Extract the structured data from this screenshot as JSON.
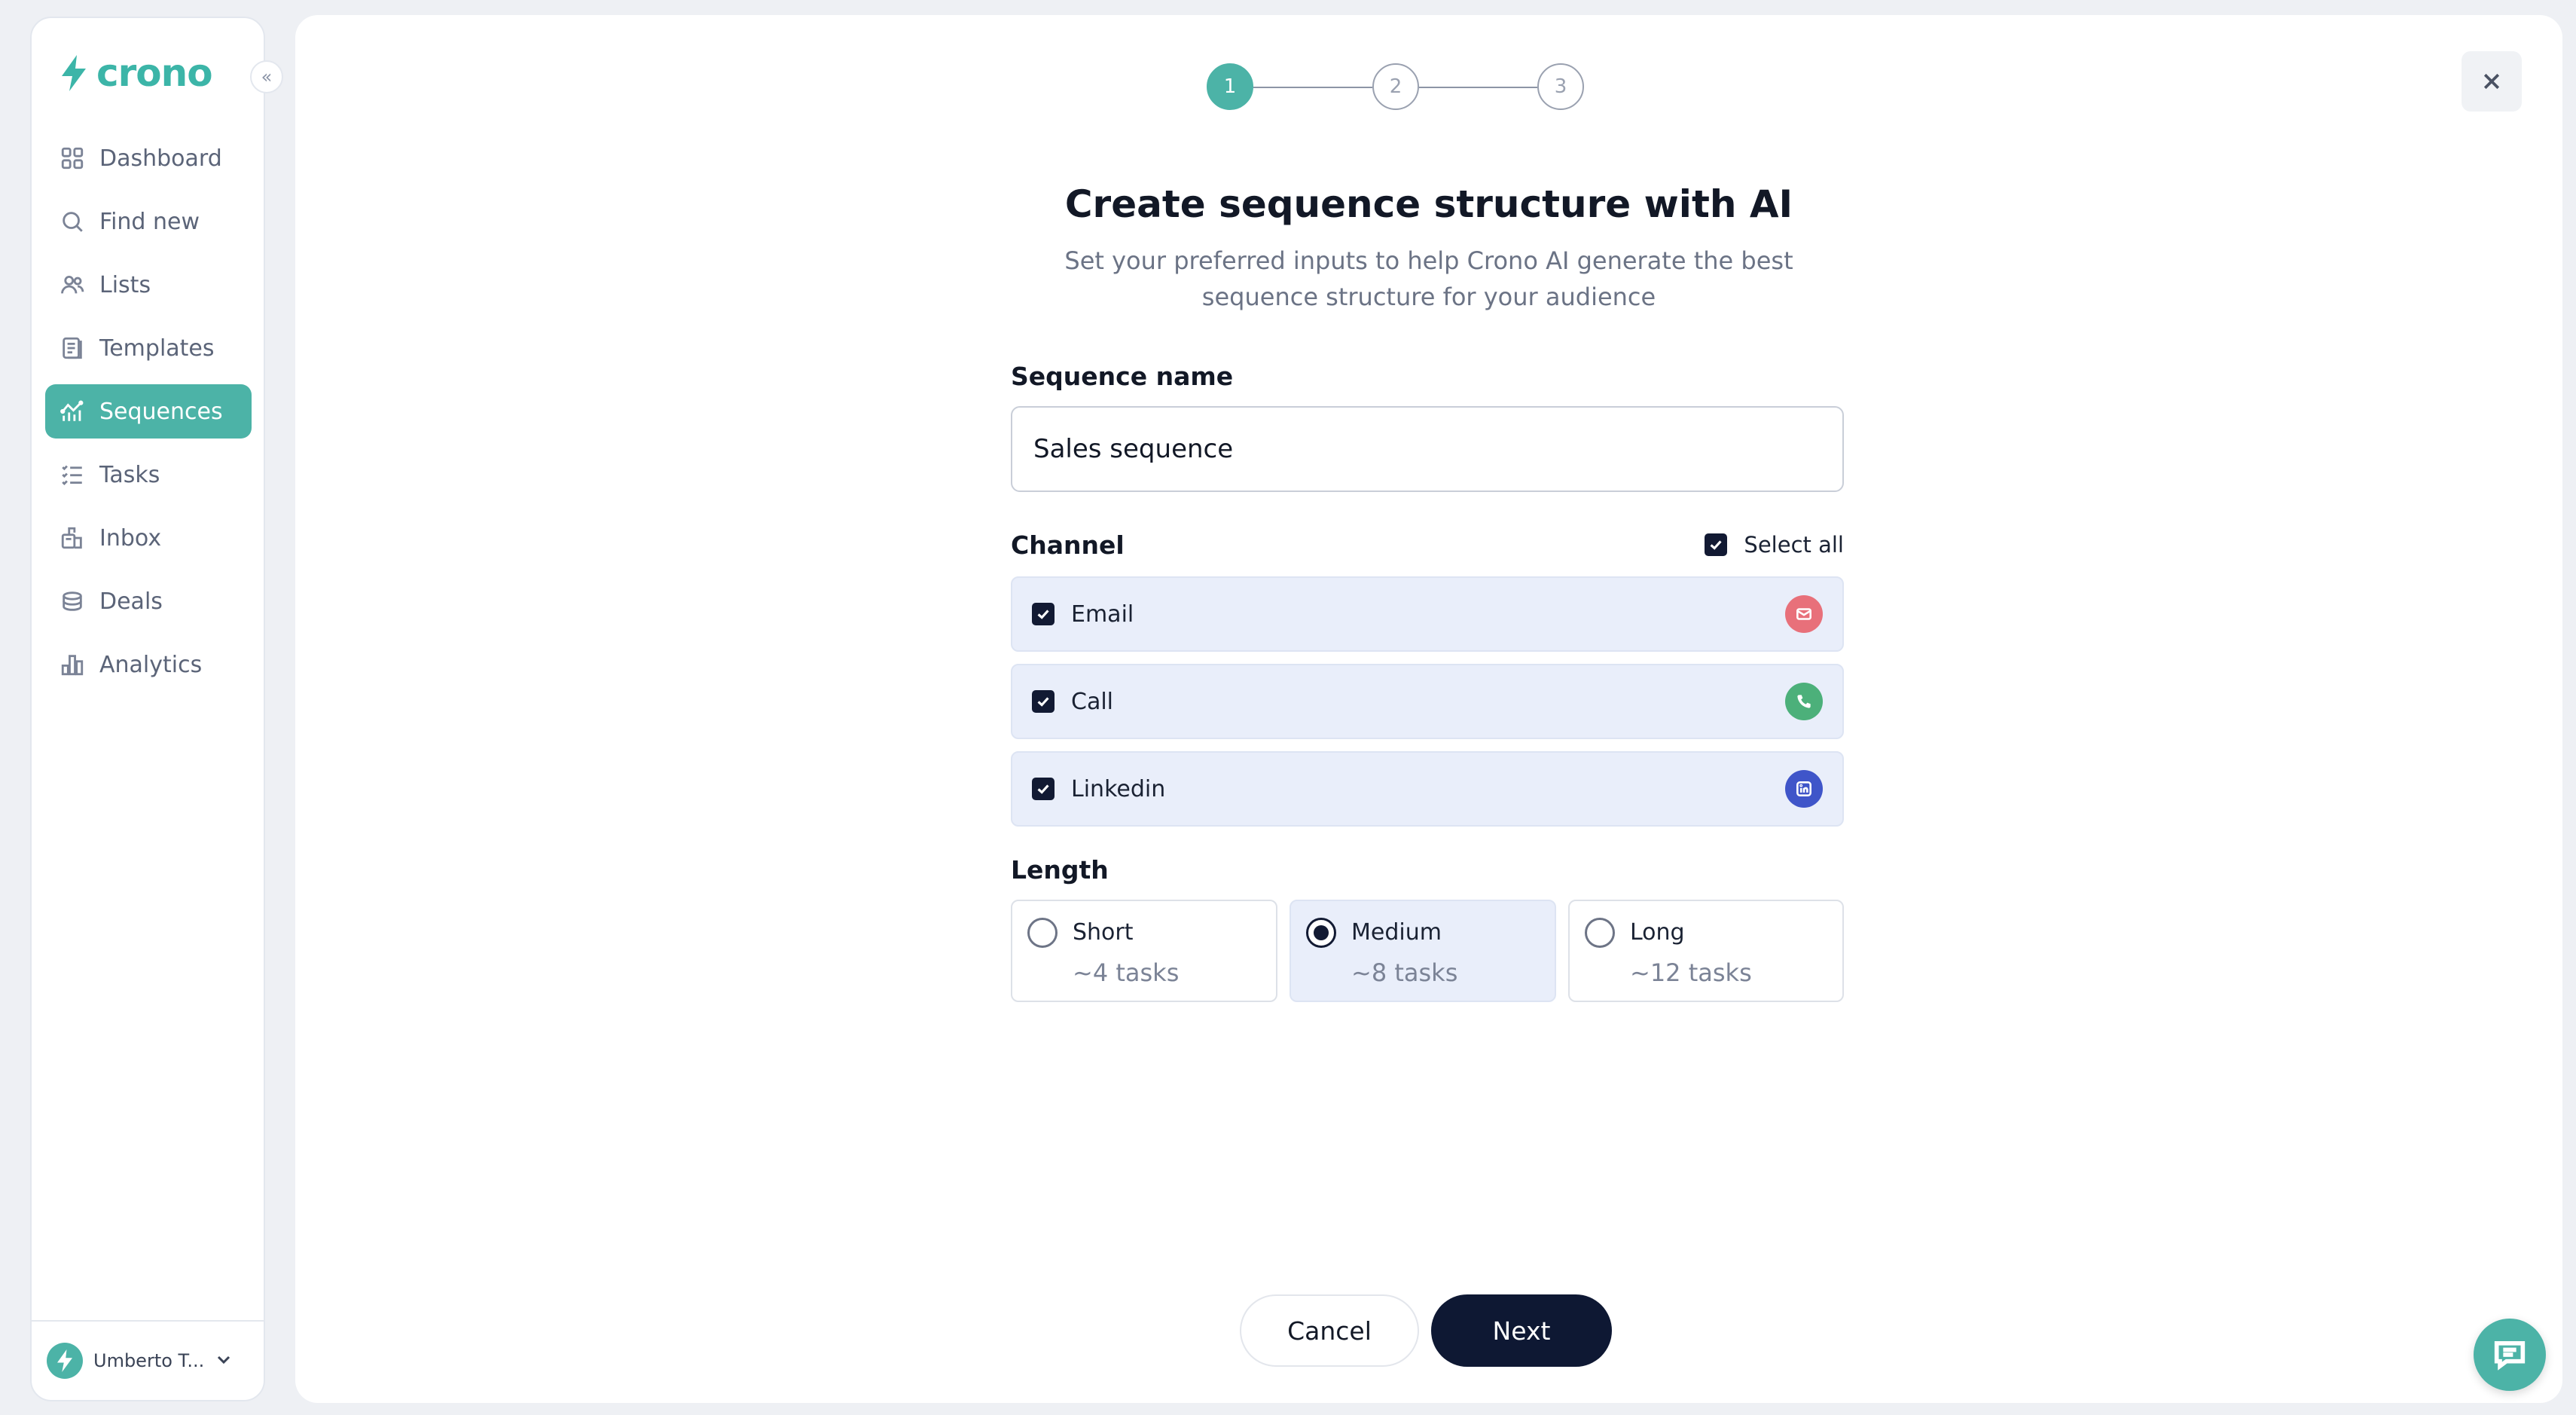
{
  "app": {
    "logo_text": "crono",
    "brand_color": "#4cb3a7"
  },
  "sidebar": {
    "collapse_glyph": "«",
    "items": [
      {
        "label": "Dashboard",
        "icon": "dashboard-icon",
        "active": false
      },
      {
        "label": "Find new",
        "icon": "search-icon",
        "active": false
      },
      {
        "label": "Lists",
        "icon": "users-icon",
        "active": false
      },
      {
        "label": "Templates",
        "icon": "templates-icon",
        "active": false
      },
      {
        "label": "Sequences",
        "icon": "sequences-icon",
        "active": true
      },
      {
        "label": "Tasks",
        "icon": "tasks-icon",
        "active": false
      },
      {
        "label": "Inbox",
        "icon": "inbox-icon",
        "active": false
      },
      {
        "label": "Deals",
        "icon": "deals-icon",
        "active": false
      },
      {
        "label": "Analytics",
        "icon": "analytics-icon",
        "active": false
      }
    ],
    "user": {
      "name": "Umberto T..."
    }
  },
  "wizard": {
    "steps": [
      "1",
      "2",
      "3"
    ],
    "current_step": 1,
    "title": "Create sequence structure with AI",
    "subtitle": "Set your preferred inputs to help Crono AI generate the best sequence structure for your audience",
    "sequence_name": {
      "label": "Sequence name",
      "value": "Sales sequence"
    },
    "channel": {
      "label": "Channel",
      "select_all_label": "Select all",
      "select_all_checked": true,
      "options": [
        {
          "label": "Email",
          "checked": true,
          "icon": "mail-icon",
          "color": "#e8707a"
        },
        {
          "label": "Call",
          "checked": true,
          "icon": "phone-icon",
          "color": "#4cb07a"
        },
        {
          "label": "Linkedin",
          "checked": true,
          "icon": "linkedin-icon",
          "color": "#3f55c9"
        }
      ]
    },
    "length": {
      "label": "Length",
      "options": [
        {
          "title": "Short",
          "subtitle": "~4 tasks",
          "selected": false
        },
        {
          "title": "Medium",
          "subtitle": "~8 tasks",
          "selected": true
        },
        {
          "title": "Long",
          "subtitle": "~12 tasks",
          "selected": false
        }
      ]
    },
    "buttons": {
      "cancel": "Cancel",
      "next": "Next"
    }
  }
}
